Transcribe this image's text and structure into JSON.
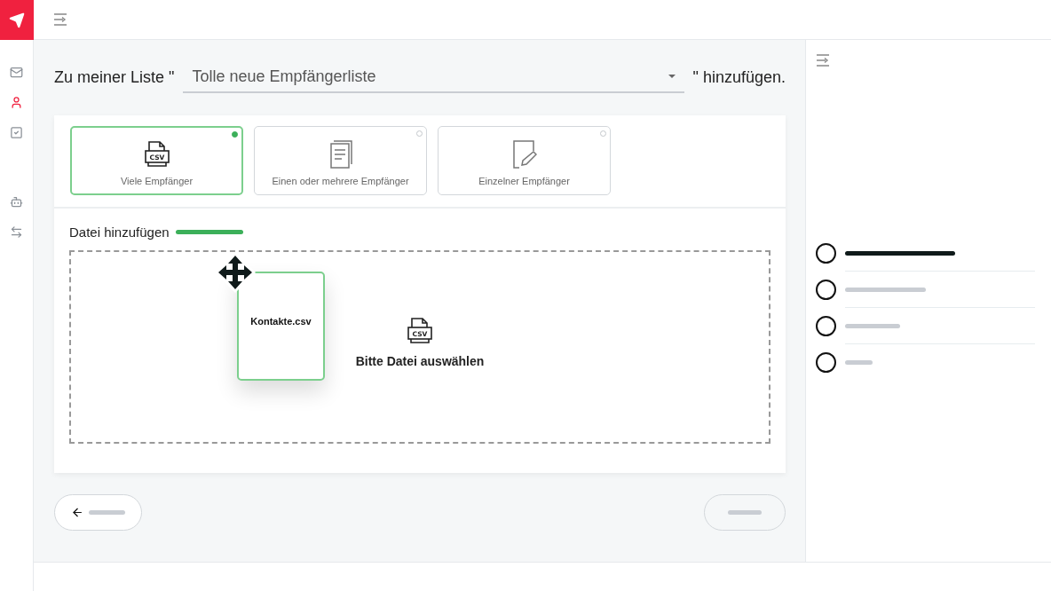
{
  "heading": {
    "prefix": "Zu meiner Liste \"",
    "list_value": "Tolle neue Empfängerliste",
    "suffix": "\" hinzufügen."
  },
  "sidebar": {
    "items": [
      {
        "kind": "mail",
        "selected": false
      },
      {
        "kind": "user",
        "selected": true
      },
      {
        "kind": "tasks",
        "selected": false
      },
      {
        "kind": "bot",
        "selected": false
      },
      {
        "kind": "transfer",
        "selected": false
      }
    ]
  },
  "options": [
    {
      "kind": "csv",
      "label": "Viele Empfänger",
      "icon_text": "CSV",
      "selected": true
    },
    {
      "kind": "document",
      "label": "Einen oder mehrere Empfänger",
      "selected": false
    },
    {
      "kind": "edit",
      "label": "Einzelner Empfänger",
      "selected": false
    }
  ],
  "upload": {
    "title": "Datei hinzufügen",
    "dragged_file": "Kontakte.csv",
    "icon_text": "CSV",
    "prompt": "Bitte Datei auswählen"
  },
  "steps": [
    {
      "selected": true
    },
    {
      "selected": false
    },
    {
      "selected": false
    },
    {
      "selected": false
    }
  ],
  "footer": {
    "next_disabled": true
  }
}
